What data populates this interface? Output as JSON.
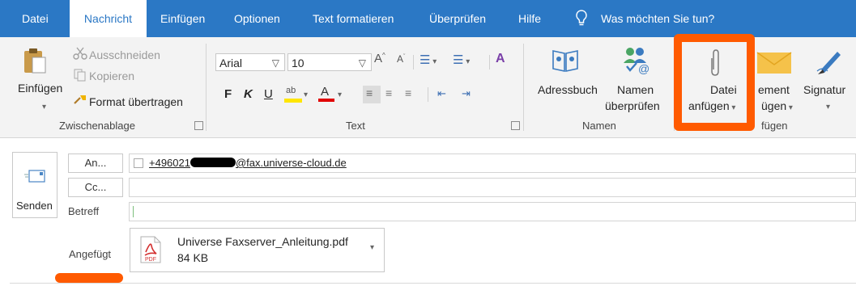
{
  "menu": {
    "tabs": [
      {
        "label": "Datei"
      },
      {
        "label": "Nachricht"
      },
      {
        "label": "Einfügen"
      },
      {
        "label": "Optionen"
      },
      {
        "label": "Text formatieren"
      },
      {
        "label": "Überprüfen"
      },
      {
        "label": "Hilfe"
      }
    ],
    "tell_me": "Was möchten Sie tun?",
    "active_tab": "Nachricht"
  },
  "clipboard": {
    "paste_label": "Einfügen",
    "cut_label": "Ausschneiden",
    "copy_label": "Kopieren",
    "format_painter_label": "Format übertragen",
    "group_label": "Zwischenablage"
  },
  "text_group": {
    "font_name": "Arial",
    "font_size": "10",
    "bold": "F",
    "italic": "K",
    "underline": "U",
    "group_label": "Text"
  },
  "names_group": {
    "address_book": "Adressbuch",
    "check_names_line1": "Namen",
    "check_names_line2": "überprüfen",
    "group_label": "Namen"
  },
  "include_group": {
    "attach_file_line1": "Datei",
    "attach_file_line2": "anfügen",
    "attach_item_line1": "ement",
    "attach_item_line2": "ügen",
    "signature": "Signatur",
    "group_label": "fügen"
  },
  "compose": {
    "send_label": "Senden",
    "to_button": "An...",
    "cc_button": "Cc...",
    "subject_label": "Betreff",
    "to_recipient_prefix": "+496021",
    "to_recipient_suffix": "@fax.universe-cloud.de",
    "attached_label": "Angefügt",
    "attachment_name": "Universe Faxserver_Anleitung.pdf",
    "attachment_size": "84 KB",
    "attachment_badge": "PDF"
  },
  "colors": {
    "accent": "#2b78c5",
    "highlight": "#ff5a00",
    "pdf_red": "#d32f2f"
  }
}
